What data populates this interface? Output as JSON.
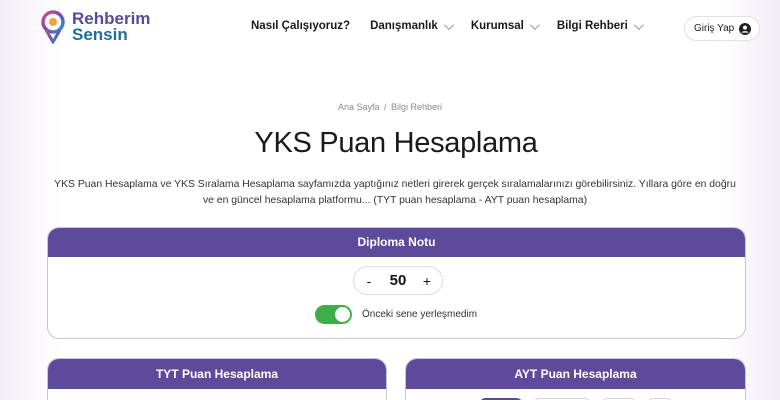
{
  "brand": {
    "line1": "Rehberim",
    "line2": "Sensin"
  },
  "nav": [
    {
      "label": "Nasıl Çalışıyoruz?",
      "dropdown": false
    },
    {
      "label": "Danışmanlık",
      "dropdown": true
    },
    {
      "label": "Kurumsal",
      "dropdown": true
    },
    {
      "label": "Bilgi Rehberi",
      "dropdown": true
    }
  ],
  "login": {
    "label": "Giriş Yap",
    "icon": "user-circle-icon"
  },
  "breadcrumb": {
    "home": "Ana Sayfa",
    "separator": "/",
    "current": "Bilgi Rehberi"
  },
  "page": {
    "title": "YKS Puan Hesaplama",
    "intro": "YKS Puan Hesaplama ve YKS Sıralama Hesaplama sayfamızda yaptığınız netleri girerek gerçek sıralamalarınızı görebilirsiniz. Yıllara göre en doğru ve en güncel hesaplama platformu... (TYT puan hesaplama - AYT puan hesaplama)"
  },
  "diploma": {
    "title": "Diploma Notu",
    "minus": "-",
    "value": "50",
    "plus": "+",
    "toggle_label": "Önceki sene yerleşmedim",
    "toggle_on": true
  },
  "tyt": {
    "title": "TYT Puan Hesaplama"
  },
  "ayt": {
    "title": "AYT Puan Hesaplama"
  },
  "colors": {
    "accent": "#5e4a9a",
    "toggle": "#3fae4a",
    "brand_blue": "#1f6f9e"
  }
}
